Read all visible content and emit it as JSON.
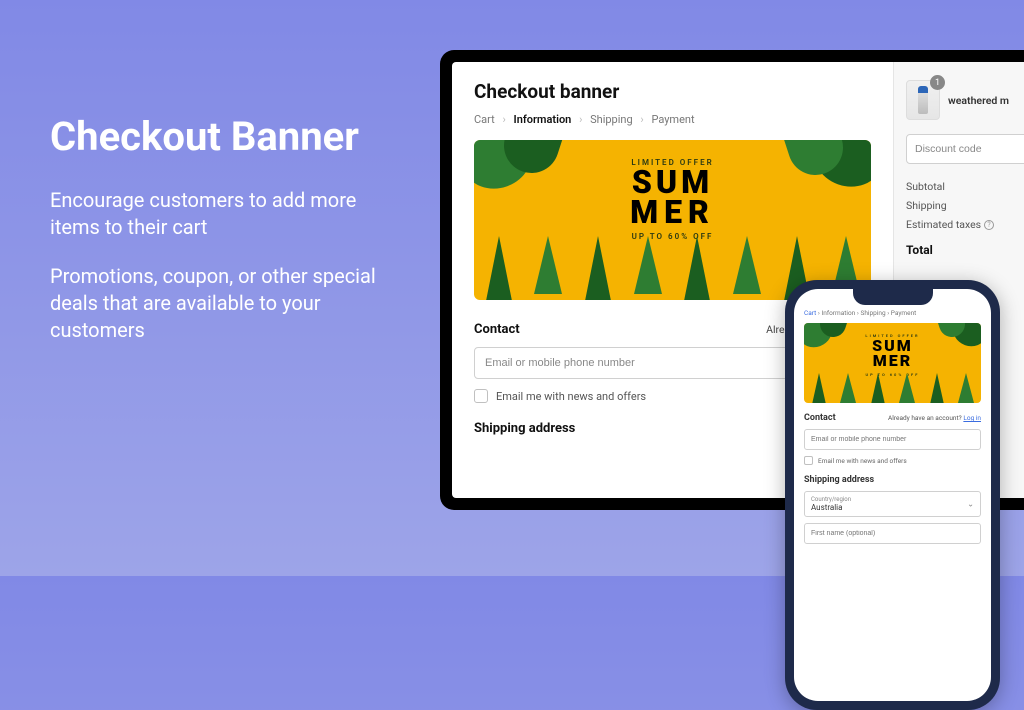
{
  "marketing": {
    "title": "Checkout Banner",
    "p1": "Encourage customers to add more items to their cart",
    "p2": "Promotions, coupon, or other special deals that are available to your customers"
  },
  "desktop": {
    "page_title": "Checkout banner",
    "breadcrumb": {
      "cart": "Cart",
      "information": "Information",
      "shipping": "Shipping",
      "payment": "Payment"
    },
    "banner": {
      "limited": "LIMITED OFFER",
      "line1": "SUM",
      "line2": "MER",
      "off": "UP TO 60% OFF"
    },
    "contact": {
      "title": "Contact",
      "already": "Already have an accou",
      "email_ph": "Email or mobile phone number",
      "news": "Email me with news and offers"
    },
    "shipping_title": "Shipping address"
  },
  "sidebar": {
    "item": {
      "qty": "1",
      "name": "weathered m"
    },
    "discount_ph": "Discount code",
    "subtotal_label": "Subtotal",
    "shipping_label": "Shipping",
    "taxes_label": "Estimated taxes",
    "total_label": "Total"
  },
  "phone": {
    "breadcrumb": {
      "cart": "Cart",
      "information": "Information",
      "shipping": "Shipping",
      "payment": "Payment"
    },
    "banner": {
      "limited": "LIMITED OFFER",
      "line1": "SUM",
      "line2": "MER",
      "off": "UP TO 60% OFF"
    },
    "contact": {
      "title": "Contact",
      "already": "Already have an account?",
      "login": "Log in",
      "email_ph": "Email or mobile phone number",
      "news": "Email me with news and offers"
    },
    "shipping": {
      "title": "Shipping address",
      "country_label": "Country/region",
      "country_value": "Australia",
      "first_name_ph": "First name (optional)"
    }
  }
}
